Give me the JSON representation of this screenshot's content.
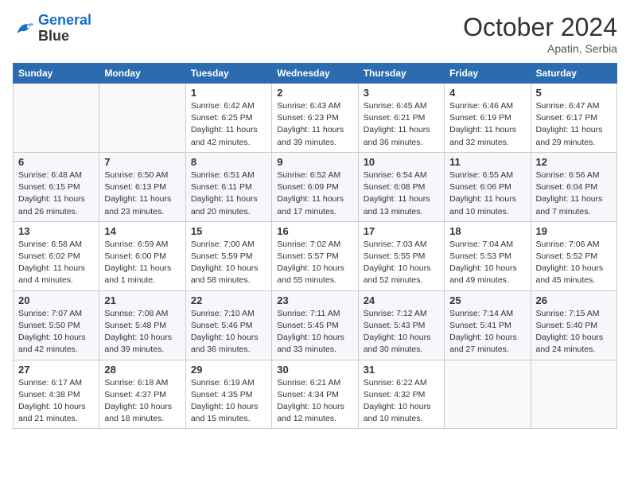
{
  "header": {
    "logo_line1": "General",
    "logo_line2": "Blue",
    "month": "October 2024",
    "location": "Apatin, Serbia"
  },
  "weekdays": [
    "Sunday",
    "Monday",
    "Tuesday",
    "Wednesday",
    "Thursday",
    "Friday",
    "Saturday"
  ],
  "weeks": [
    [
      {
        "day": "",
        "info": ""
      },
      {
        "day": "",
        "info": ""
      },
      {
        "day": "1",
        "info": "Sunrise: 6:42 AM\nSunset: 6:25 PM\nDaylight: 11 hours and 42 minutes."
      },
      {
        "day": "2",
        "info": "Sunrise: 6:43 AM\nSunset: 6:23 PM\nDaylight: 11 hours and 39 minutes."
      },
      {
        "day": "3",
        "info": "Sunrise: 6:45 AM\nSunset: 6:21 PM\nDaylight: 11 hours and 36 minutes."
      },
      {
        "day": "4",
        "info": "Sunrise: 6:46 AM\nSunset: 6:19 PM\nDaylight: 11 hours and 32 minutes."
      },
      {
        "day": "5",
        "info": "Sunrise: 6:47 AM\nSunset: 6:17 PM\nDaylight: 11 hours and 29 minutes."
      }
    ],
    [
      {
        "day": "6",
        "info": "Sunrise: 6:48 AM\nSunset: 6:15 PM\nDaylight: 11 hours and 26 minutes."
      },
      {
        "day": "7",
        "info": "Sunrise: 6:50 AM\nSunset: 6:13 PM\nDaylight: 11 hours and 23 minutes."
      },
      {
        "day": "8",
        "info": "Sunrise: 6:51 AM\nSunset: 6:11 PM\nDaylight: 11 hours and 20 minutes."
      },
      {
        "day": "9",
        "info": "Sunrise: 6:52 AM\nSunset: 6:09 PM\nDaylight: 11 hours and 17 minutes."
      },
      {
        "day": "10",
        "info": "Sunrise: 6:54 AM\nSunset: 6:08 PM\nDaylight: 11 hours and 13 minutes."
      },
      {
        "day": "11",
        "info": "Sunrise: 6:55 AM\nSunset: 6:06 PM\nDaylight: 11 hours and 10 minutes."
      },
      {
        "day": "12",
        "info": "Sunrise: 6:56 AM\nSunset: 6:04 PM\nDaylight: 11 hours and 7 minutes."
      }
    ],
    [
      {
        "day": "13",
        "info": "Sunrise: 6:58 AM\nSunset: 6:02 PM\nDaylight: 11 hours and 4 minutes."
      },
      {
        "day": "14",
        "info": "Sunrise: 6:59 AM\nSunset: 6:00 PM\nDaylight: 11 hours and 1 minute."
      },
      {
        "day": "15",
        "info": "Sunrise: 7:00 AM\nSunset: 5:59 PM\nDaylight: 10 hours and 58 minutes."
      },
      {
        "day": "16",
        "info": "Sunrise: 7:02 AM\nSunset: 5:57 PM\nDaylight: 10 hours and 55 minutes."
      },
      {
        "day": "17",
        "info": "Sunrise: 7:03 AM\nSunset: 5:55 PM\nDaylight: 10 hours and 52 minutes."
      },
      {
        "day": "18",
        "info": "Sunrise: 7:04 AM\nSunset: 5:53 PM\nDaylight: 10 hours and 49 minutes."
      },
      {
        "day": "19",
        "info": "Sunrise: 7:06 AM\nSunset: 5:52 PM\nDaylight: 10 hours and 45 minutes."
      }
    ],
    [
      {
        "day": "20",
        "info": "Sunrise: 7:07 AM\nSunset: 5:50 PM\nDaylight: 10 hours and 42 minutes."
      },
      {
        "day": "21",
        "info": "Sunrise: 7:08 AM\nSunset: 5:48 PM\nDaylight: 10 hours and 39 minutes."
      },
      {
        "day": "22",
        "info": "Sunrise: 7:10 AM\nSunset: 5:46 PM\nDaylight: 10 hours and 36 minutes."
      },
      {
        "day": "23",
        "info": "Sunrise: 7:11 AM\nSunset: 5:45 PM\nDaylight: 10 hours and 33 minutes."
      },
      {
        "day": "24",
        "info": "Sunrise: 7:12 AM\nSunset: 5:43 PM\nDaylight: 10 hours and 30 minutes."
      },
      {
        "day": "25",
        "info": "Sunrise: 7:14 AM\nSunset: 5:41 PM\nDaylight: 10 hours and 27 minutes."
      },
      {
        "day": "26",
        "info": "Sunrise: 7:15 AM\nSunset: 5:40 PM\nDaylight: 10 hours and 24 minutes."
      }
    ],
    [
      {
        "day": "27",
        "info": "Sunrise: 6:17 AM\nSunset: 4:38 PM\nDaylight: 10 hours and 21 minutes."
      },
      {
        "day": "28",
        "info": "Sunrise: 6:18 AM\nSunset: 4:37 PM\nDaylight: 10 hours and 18 minutes."
      },
      {
        "day": "29",
        "info": "Sunrise: 6:19 AM\nSunset: 4:35 PM\nDaylight: 10 hours and 15 minutes."
      },
      {
        "day": "30",
        "info": "Sunrise: 6:21 AM\nSunset: 4:34 PM\nDaylight: 10 hours and 12 minutes."
      },
      {
        "day": "31",
        "info": "Sunrise: 6:22 AM\nSunset: 4:32 PM\nDaylight: 10 hours and 10 minutes."
      },
      {
        "day": "",
        "info": ""
      },
      {
        "day": "",
        "info": ""
      }
    ]
  ]
}
